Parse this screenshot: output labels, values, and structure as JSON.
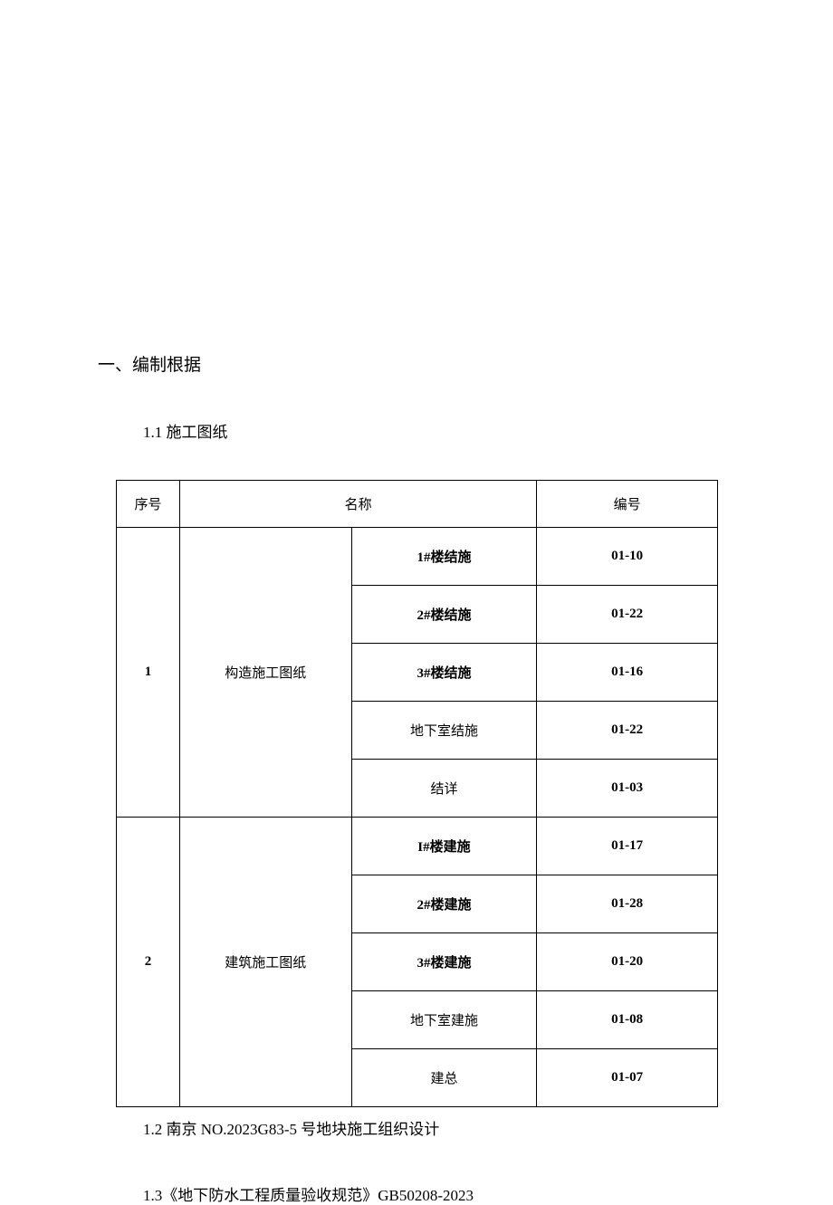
{
  "section_heading": "一、编制根据",
  "subsection_1_1": "1.1 施工图纸",
  "table": {
    "headers": {
      "seq": "序号",
      "name": "名称",
      "code": "编号"
    },
    "groups": [
      {
        "seq": "1",
        "category": "构造施工图纸",
        "rows": [
          {
            "name": "1#楼结施",
            "code": "01-10"
          },
          {
            "name": "2#楼结施",
            "code": "01-22"
          },
          {
            "name": "3#楼结施",
            "code": "01-16"
          },
          {
            "name": "地下室结施",
            "code": "01-22"
          },
          {
            "name": "结详",
            "code": "01-03"
          }
        ]
      },
      {
        "seq": "2",
        "category": "建筑施工图纸",
        "rows": [
          {
            "name": "I#楼建施",
            "code": "01-17"
          },
          {
            "name": "2#楼建施",
            "code": "01-28"
          },
          {
            "name": "3#楼建施",
            "code": "01-20"
          },
          {
            "name": "地下室建施",
            "code": "01-08"
          },
          {
            "name": "建总",
            "code": "01-07"
          }
        ]
      }
    ]
  },
  "subsection_1_2": "1.2 南京 NO.2023G83-5 号地块施工组织设计",
  "subsection_1_3": "1.3《地下防水工程质量验收规范》GB50208-2023"
}
